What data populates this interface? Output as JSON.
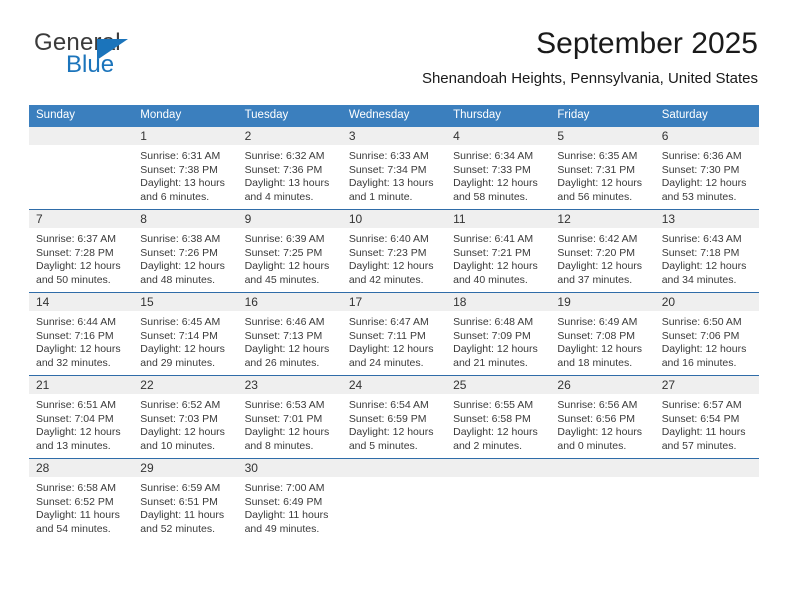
{
  "brand": {
    "name_top": "General",
    "name_bottom": "Blue",
    "accent_color": "#1b74bb",
    "flag_icon": "triangle-flag-icon"
  },
  "header": {
    "title": "September 2025",
    "subtitle": "Shenandoah Heights, Pennsylvania, United States"
  },
  "theme": {
    "header_blue": "#3b7fbe",
    "row_divider_blue": "#2f6ca8",
    "daynum_band_gray": "#efefef",
    "text_color": "#3a3a3a"
  },
  "weekdays": [
    "Sunday",
    "Monday",
    "Tuesday",
    "Wednesday",
    "Thursday",
    "Friday",
    "Saturday"
  ],
  "weeks": [
    [
      {
        "day": "",
        "empty": true,
        "sunrise": "",
        "sunset": "",
        "daylight_1": "",
        "daylight_2": ""
      },
      {
        "day": "1",
        "empty": false,
        "sunrise": "Sunrise: 6:31 AM",
        "sunset": "Sunset: 7:38 PM",
        "daylight_1": "Daylight: 13 hours",
        "daylight_2": "and 6 minutes."
      },
      {
        "day": "2",
        "empty": false,
        "sunrise": "Sunrise: 6:32 AM",
        "sunset": "Sunset: 7:36 PM",
        "daylight_1": "Daylight: 13 hours",
        "daylight_2": "and 4 minutes."
      },
      {
        "day": "3",
        "empty": false,
        "sunrise": "Sunrise: 6:33 AM",
        "sunset": "Sunset: 7:34 PM",
        "daylight_1": "Daylight: 13 hours",
        "daylight_2": "and 1 minute."
      },
      {
        "day": "4",
        "empty": false,
        "sunrise": "Sunrise: 6:34 AM",
        "sunset": "Sunset: 7:33 PM",
        "daylight_1": "Daylight: 12 hours",
        "daylight_2": "and 58 minutes."
      },
      {
        "day": "5",
        "empty": false,
        "sunrise": "Sunrise: 6:35 AM",
        "sunset": "Sunset: 7:31 PM",
        "daylight_1": "Daylight: 12 hours",
        "daylight_2": "and 56 minutes."
      },
      {
        "day": "6",
        "empty": false,
        "sunrise": "Sunrise: 6:36 AM",
        "sunset": "Sunset: 7:30 PM",
        "daylight_1": "Daylight: 12 hours",
        "daylight_2": "and 53 minutes."
      }
    ],
    [
      {
        "day": "7",
        "empty": false,
        "sunrise": "Sunrise: 6:37 AM",
        "sunset": "Sunset: 7:28 PM",
        "daylight_1": "Daylight: 12 hours",
        "daylight_2": "and 50 minutes."
      },
      {
        "day": "8",
        "empty": false,
        "sunrise": "Sunrise: 6:38 AM",
        "sunset": "Sunset: 7:26 PM",
        "daylight_1": "Daylight: 12 hours",
        "daylight_2": "and 48 minutes."
      },
      {
        "day": "9",
        "empty": false,
        "sunrise": "Sunrise: 6:39 AM",
        "sunset": "Sunset: 7:25 PM",
        "daylight_1": "Daylight: 12 hours",
        "daylight_2": "and 45 minutes."
      },
      {
        "day": "10",
        "empty": false,
        "sunrise": "Sunrise: 6:40 AM",
        "sunset": "Sunset: 7:23 PM",
        "daylight_1": "Daylight: 12 hours",
        "daylight_2": "and 42 minutes."
      },
      {
        "day": "11",
        "empty": false,
        "sunrise": "Sunrise: 6:41 AM",
        "sunset": "Sunset: 7:21 PM",
        "daylight_1": "Daylight: 12 hours",
        "daylight_2": "and 40 minutes."
      },
      {
        "day": "12",
        "empty": false,
        "sunrise": "Sunrise: 6:42 AM",
        "sunset": "Sunset: 7:20 PM",
        "daylight_1": "Daylight: 12 hours",
        "daylight_2": "and 37 minutes."
      },
      {
        "day": "13",
        "empty": false,
        "sunrise": "Sunrise: 6:43 AM",
        "sunset": "Sunset: 7:18 PM",
        "daylight_1": "Daylight: 12 hours",
        "daylight_2": "and 34 minutes."
      }
    ],
    [
      {
        "day": "14",
        "empty": false,
        "sunrise": "Sunrise: 6:44 AM",
        "sunset": "Sunset: 7:16 PM",
        "daylight_1": "Daylight: 12 hours",
        "daylight_2": "and 32 minutes."
      },
      {
        "day": "15",
        "empty": false,
        "sunrise": "Sunrise: 6:45 AM",
        "sunset": "Sunset: 7:14 PM",
        "daylight_1": "Daylight: 12 hours",
        "daylight_2": "and 29 minutes."
      },
      {
        "day": "16",
        "empty": false,
        "sunrise": "Sunrise: 6:46 AM",
        "sunset": "Sunset: 7:13 PM",
        "daylight_1": "Daylight: 12 hours",
        "daylight_2": "and 26 minutes."
      },
      {
        "day": "17",
        "empty": false,
        "sunrise": "Sunrise: 6:47 AM",
        "sunset": "Sunset: 7:11 PM",
        "daylight_1": "Daylight: 12 hours",
        "daylight_2": "and 24 minutes."
      },
      {
        "day": "18",
        "empty": false,
        "sunrise": "Sunrise: 6:48 AM",
        "sunset": "Sunset: 7:09 PM",
        "daylight_1": "Daylight: 12 hours",
        "daylight_2": "and 21 minutes."
      },
      {
        "day": "19",
        "empty": false,
        "sunrise": "Sunrise: 6:49 AM",
        "sunset": "Sunset: 7:08 PM",
        "daylight_1": "Daylight: 12 hours",
        "daylight_2": "and 18 minutes."
      },
      {
        "day": "20",
        "empty": false,
        "sunrise": "Sunrise: 6:50 AM",
        "sunset": "Sunset: 7:06 PM",
        "daylight_1": "Daylight: 12 hours",
        "daylight_2": "and 16 minutes."
      }
    ],
    [
      {
        "day": "21",
        "empty": false,
        "sunrise": "Sunrise: 6:51 AM",
        "sunset": "Sunset: 7:04 PM",
        "daylight_1": "Daylight: 12 hours",
        "daylight_2": "and 13 minutes."
      },
      {
        "day": "22",
        "empty": false,
        "sunrise": "Sunrise: 6:52 AM",
        "sunset": "Sunset: 7:03 PM",
        "daylight_1": "Daylight: 12 hours",
        "daylight_2": "and 10 minutes."
      },
      {
        "day": "23",
        "empty": false,
        "sunrise": "Sunrise: 6:53 AM",
        "sunset": "Sunset: 7:01 PM",
        "daylight_1": "Daylight: 12 hours",
        "daylight_2": "and 8 minutes."
      },
      {
        "day": "24",
        "empty": false,
        "sunrise": "Sunrise: 6:54 AM",
        "sunset": "Sunset: 6:59 PM",
        "daylight_1": "Daylight: 12 hours",
        "daylight_2": "and 5 minutes."
      },
      {
        "day": "25",
        "empty": false,
        "sunrise": "Sunrise: 6:55 AM",
        "sunset": "Sunset: 6:58 PM",
        "daylight_1": "Daylight: 12 hours",
        "daylight_2": "and 2 minutes."
      },
      {
        "day": "26",
        "empty": false,
        "sunrise": "Sunrise: 6:56 AM",
        "sunset": "Sunset: 6:56 PM",
        "daylight_1": "Daylight: 12 hours",
        "daylight_2": "and 0 minutes."
      },
      {
        "day": "27",
        "empty": false,
        "sunrise": "Sunrise: 6:57 AM",
        "sunset": "Sunset: 6:54 PM",
        "daylight_1": "Daylight: 11 hours",
        "daylight_2": "and 57 minutes."
      }
    ],
    [
      {
        "day": "28",
        "empty": false,
        "sunrise": "Sunrise: 6:58 AM",
        "sunset": "Sunset: 6:52 PM",
        "daylight_1": "Daylight: 11 hours",
        "daylight_2": "and 54 minutes."
      },
      {
        "day": "29",
        "empty": false,
        "sunrise": "Sunrise: 6:59 AM",
        "sunset": "Sunset: 6:51 PM",
        "daylight_1": "Daylight: 11 hours",
        "daylight_2": "and 52 minutes."
      },
      {
        "day": "30",
        "empty": false,
        "sunrise": "Sunrise: 7:00 AM",
        "sunset": "Sunset: 6:49 PM",
        "daylight_1": "Daylight: 11 hours",
        "daylight_2": "and 49 minutes."
      },
      {
        "day": "",
        "empty": true,
        "sunrise": "",
        "sunset": "",
        "daylight_1": "",
        "daylight_2": ""
      },
      {
        "day": "",
        "empty": true,
        "sunrise": "",
        "sunset": "",
        "daylight_1": "",
        "daylight_2": ""
      },
      {
        "day": "",
        "empty": true,
        "sunrise": "",
        "sunset": "",
        "daylight_1": "",
        "daylight_2": ""
      },
      {
        "day": "",
        "empty": true,
        "sunrise": "",
        "sunset": "",
        "daylight_1": "",
        "daylight_2": ""
      }
    ]
  ]
}
